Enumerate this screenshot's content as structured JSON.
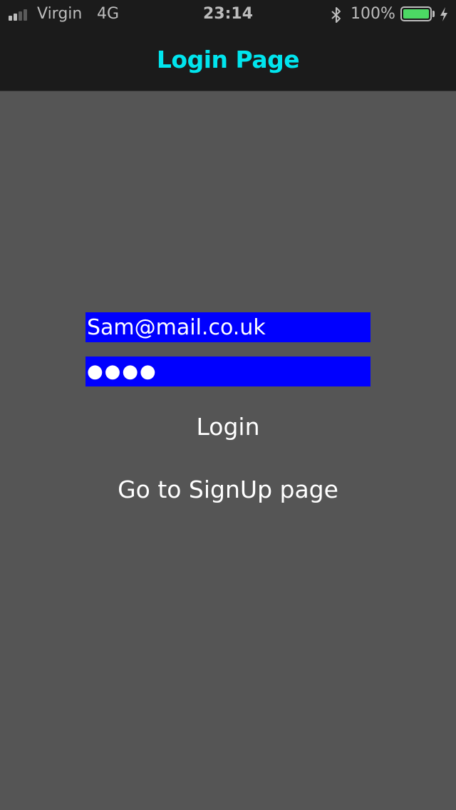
{
  "status_bar": {
    "carrier": "Virgin",
    "network": "4G",
    "time": "23:14",
    "battery_percent": "100%",
    "icons": {
      "signal": "cellular-signal-icon",
      "bluetooth": "bluetooth-icon",
      "battery": "battery-icon",
      "charging": "charging-bolt-icon"
    },
    "signal_bars_active": 2,
    "signal_bars_total": 4,
    "battery_level": 1.0,
    "colors": {
      "battery_fill": "#4cd964",
      "text": "#bdbdbd",
      "signal_inactive": "#5a5a5a"
    }
  },
  "header": {
    "title": "Login Page",
    "title_color": "#00e5ee",
    "background": "#1b1b1b"
  },
  "form": {
    "email": {
      "value": "Sam@mail.co.uk"
    },
    "password": {
      "masked_value": "●●●●"
    },
    "field_background": "#0000ff",
    "login_label": "Login",
    "signup_label": "Go to SignUp page"
  },
  "colors": {
    "page_background": "#555555",
    "text": "#ffffff"
  }
}
